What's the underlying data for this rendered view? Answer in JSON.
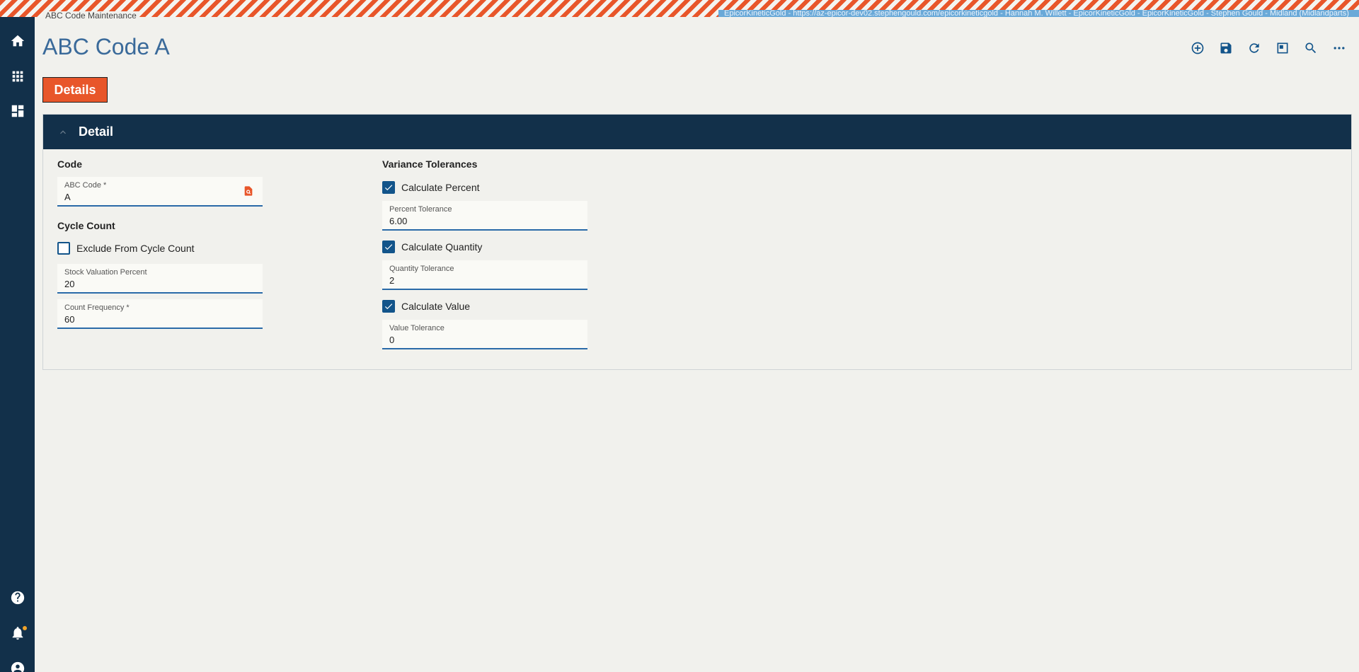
{
  "breadcrumb": "ABC Code Maintenance",
  "env_info": "EpicorKineticGold - https://az-epicor-dev02.stephengould.com/epicorkineticgold - Hannah M. Willett - EpicorKineticGold - EpicorKineticGold - Stephen Gould - Midland (Midlandparts)",
  "page_title": "ABC Code A",
  "tab_label": "Details",
  "panel_title": "Detail",
  "sidebar": {
    "home": "home-icon",
    "apps": "grid-icon",
    "dashboard": "dashboard-icon",
    "help": "help-icon",
    "notifications": "bell-icon",
    "account": "user-icon"
  },
  "toolbar": [
    "add-icon",
    "save-icon",
    "refresh-icon",
    "layout-icon",
    "search-icon",
    "more-icon"
  ],
  "code_section": {
    "title": "Code",
    "abc_code_label": "ABC Code *",
    "abc_code_value": "A"
  },
  "cycle_section": {
    "title": "Cycle Count",
    "exclude_label": "Exclude From Cycle Count",
    "exclude_checked": false,
    "stock_label": "Stock Valuation Percent",
    "stock_value": "20",
    "freq_label": "Count Frequency *",
    "freq_value": "60"
  },
  "variance_section": {
    "title": "Variance Tolerances",
    "calc_percent_label": "Calculate Percent",
    "calc_percent_checked": true,
    "percent_tol_label": "Percent Tolerance",
    "percent_tol_value": "6.00",
    "calc_qty_label": "Calculate Quantity",
    "calc_qty_checked": true,
    "qty_tol_label": "Quantity Tolerance",
    "qty_tol_value": "2",
    "calc_value_label": "Calculate Value",
    "calc_value_checked": true,
    "value_tol_label": "Value Tolerance",
    "value_tol_value": "0"
  },
  "colors": {
    "accent": "#e8562a",
    "nav": "#12304a",
    "primary": "#12548a"
  }
}
